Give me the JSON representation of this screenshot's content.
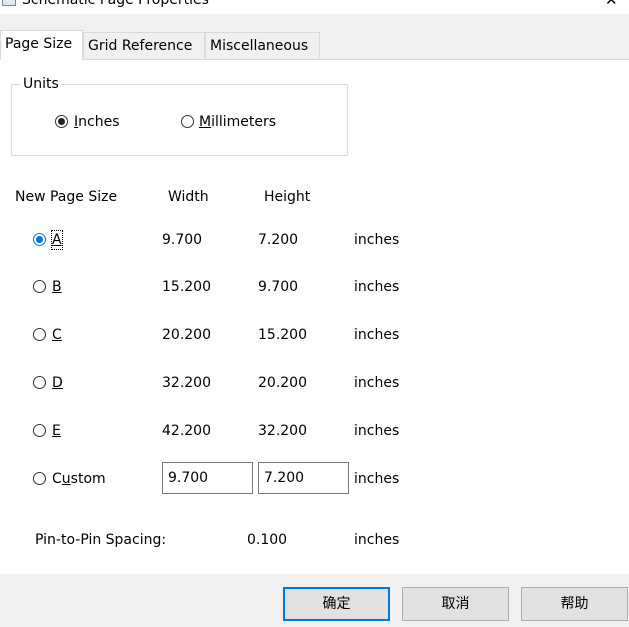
{
  "window": {
    "title": "Schematic Page Properties",
    "title_icon": "window-app-icon",
    "close_icon": "close-icon"
  },
  "tabs": [
    {
      "label": "Page Size",
      "active": true
    },
    {
      "label": "Grid Reference",
      "active": false
    },
    {
      "label": "Miscellaneous",
      "active": false
    }
  ],
  "units": {
    "label": "Units",
    "options": [
      {
        "label": "Inches",
        "accesskey": "I",
        "rest": "nches",
        "selected": true
      },
      {
        "label": "Millimeters",
        "accesskey": "M",
        "rest": "illimeters",
        "selected": false
      }
    ]
  },
  "size_table": {
    "headers": {
      "size": "New Page Size",
      "width": "Width",
      "height": "Height"
    },
    "rows": [
      {
        "label": "A",
        "width": "9.700",
        "height": "7.200",
        "unit": "inches",
        "selected": true
      },
      {
        "label": "B",
        "width": "15.200",
        "height": "9.700",
        "unit": "inches",
        "selected": false
      },
      {
        "label": "C",
        "width": "20.200",
        "height": "15.200",
        "unit": "inches",
        "selected": false
      },
      {
        "label": "D",
        "width": "32.200",
        "height": "20.200",
        "unit": "inches",
        "selected": false
      },
      {
        "label": "E",
        "width": "42.200",
        "height": "32.200",
        "unit": "inches",
        "selected": false
      }
    ],
    "custom": {
      "label": "Custom",
      "label_pre": "C",
      "label_key": "u",
      "label_post": "stom",
      "width_value": "9.700",
      "height_value": "7.200",
      "unit": "inches",
      "selected": false
    }
  },
  "pin_spacing": {
    "label": "Pin-to-Pin Spacing:",
    "value": "0.100",
    "unit": "inches"
  },
  "buttons": {
    "ok": "确定",
    "cancel": "取消",
    "help": "帮助"
  },
  "colors": {
    "accent": "#0078d7",
    "dialog_bg": "#f0f0f0",
    "pane_bg": "#ffffff"
  }
}
